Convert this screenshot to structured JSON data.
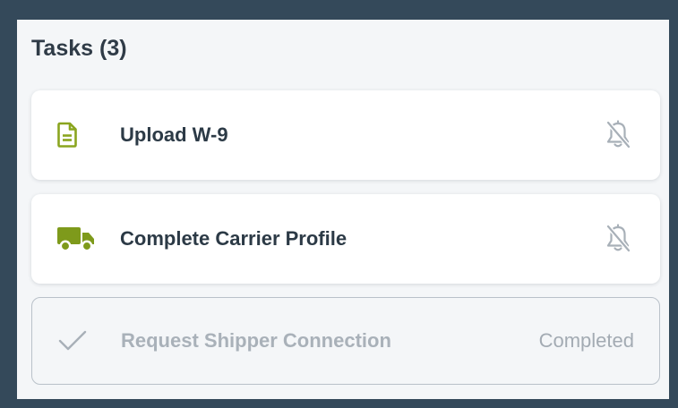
{
  "tasks_panel": {
    "title": "Tasks",
    "count": "(3)",
    "tasks": [
      {
        "label": "Upload W-9",
        "icon": "document-icon",
        "icon_color": "#8aa51f",
        "action_icon": "bell-off-icon"
      },
      {
        "label": "Complete Carrier Profile",
        "icon": "truck-icon",
        "icon_color": "#7e9a1b",
        "action_icon": "bell-off-icon"
      },
      {
        "label": "Request Shipper Connection",
        "icon": "check-icon",
        "status": "Completed"
      }
    ]
  },
  "colors": {
    "frame_background": "#34495a",
    "panel_background": "#f4f6f8",
    "accent_green": "#8aa51f",
    "muted_text": "#a9b1b9"
  }
}
